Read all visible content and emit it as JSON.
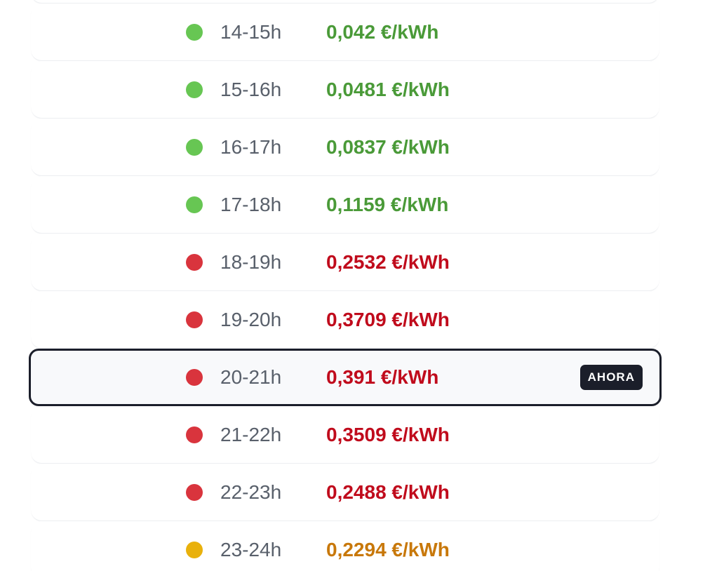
{
  "colors": {
    "green_dot": "#67c653",
    "green_text": "#4a9a38",
    "red_dot": "#d9343d",
    "red_text": "#c00b1c",
    "yellow_dot": "#e9b10c",
    "orange_text": "#c8780a"
  },
  "badge": {
    "label": "AHORA"
  },
  "rows": [
    {
      "hour": "",
      "price": "",
      "level": "green"
    },
    {
      "hour": "14-15h",
      "price": "0,042 €/kWh",
      "level": "green"
    },
    {
      "hour": "15-16h",
      "price": "0,0481 €/kWh",
      "level": "green"
    },
    {
      "hour": "16-17h",
      "price": "0,0837 €/kWh",
      "level": "green"
    },
    {
      "hour": "17-18h",
      "price": "0,1159 €/kWh",
      "level": "green"
    },
    {
      "hour": "18-19h",
      "price": "0,2532 €/kWh",
      "level": "red"
    },
    {
      "hour": "19-20h",
      "price": "0,3709 €/kWh",
      "level": "red"
    },
    {
      "hour": "20-21h",
      "price": "0,391 €/kWh",
      "level": "red",
      "current": true
    },
    {
      "hour": "21-22h",
      "price": "0,3509 €/kWh",
      "level": "red"
    },
    {
      "hour": "22-23h",
      "price": "0,2488 €/kWh",
      "level": "red"
    },
    {
      "hour": "23-24h",
      "price": "0,2294 €/kWh",
      "level": "yellow"
    }
  ]
}
